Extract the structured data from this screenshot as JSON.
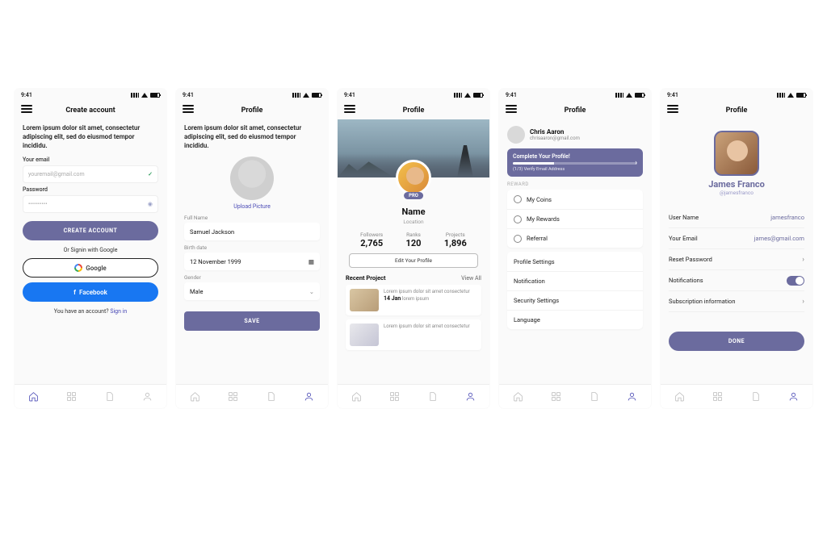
{
  "status": {
    "time": "9:41"
  },
  "nav": {
    "items": [
      "home",
      "grid",
      "doc",
      "profile"
    ]
  },
  "s1": {
    "title": "Create account",
    "intro": "Lorem ipsum dolor sit amet, consectetur adipiscing elit, sed do eiusmod tempor incididu.",
    "email_label": "Your email",
    "email_placeholder": "youremail@gmail.com",
    "password_label": "Password",
    "password_value": "••••••••••",
    "create_btn": "CREATE ACCOUNT",
    "or": "Or Signin with Google",
    "google_btn": "Google",
    "facebook_btn": "Facebook",
    "have_account": "You have an account?",
    "signin": "Sign in"
  },
  "s2": {
    "title": "Profile",
    "intro": "Lorem ipsum dolor sit amet, consectetur adipiscing elit, sed do eiusmod tempor incididu.",
    "upload": "Upload Picture",
    "fullname_label": "Full Name",
    "fullname_value": "Samuel Jackson",
    "birth_label": "Birth date",
    "birth_value": "12 November 1999",
    "gender_label": "Gender",
    "gender_value": "Male",
    "save_btn": "SAVE"
  },
  "s3": {
    "title": "Profile",
    "pro": "PRO",
    "name": "Name",
    "location": "Location",
    "stats": [
      {
        "label": "Followers",
        "value": "2,765"
      },
      {
        "label": "Ranks",
        "value": "120"
      },
      {
        "label": "Projects",
        "value": "1,896"
      }
    ],
    "edit_btn": "Edit Your Profile",
    "recent": "Recent Project",
    "view_all": "View All",
    "projects": [
      {
        "desc": "Lorem ipsum dolor sit amet consectetur",
        "date": "14 Jan",
        "extra": "lorem ipsum"
      },
      {
        "desc": "Lorem ipsum dolor sit amet consectetur",
        "date": "",
        "extra": ""
      }
    ]
  },
  "s4": {
    "title": "Profile",
    "user_name": "Chris Aaron",
    "user_email": "chrisaaron@gmail.com",
    "banner_title": "Complete Your Profile!",
    "banner_sub": "(1/3) Verify Email Address",
    "reward_label": "REWARD",
    "rewards": [
      "My Coins",
      "My Rewards",
      "Referral"
    ],
    "settings": [
      "Profile Settings",
      "Notification",
      "Security Settings",
      "Language"
    ]
  },
  "s5": {
    "title": "Profile",
    "name": "James Franco",
    "handle": "@jamesfranco",
    "rows": [
      {
        "label": "User Name",
        "value": "jamesfranco",
        "type": "text"
      },
      {
        "label": "Your Email",
        "value": "james@gmail.com",
        "type": "text"
      },
      {
        "label": "Reset Password",
        "type": "nav"
      },
      {
        "label": "Notifications",
        "type": "toggle"
      },
      {
        "label": "Subscription information",
        "type": "nav"
      }
    ],
    "done_btn": "DONE"
  }
}
